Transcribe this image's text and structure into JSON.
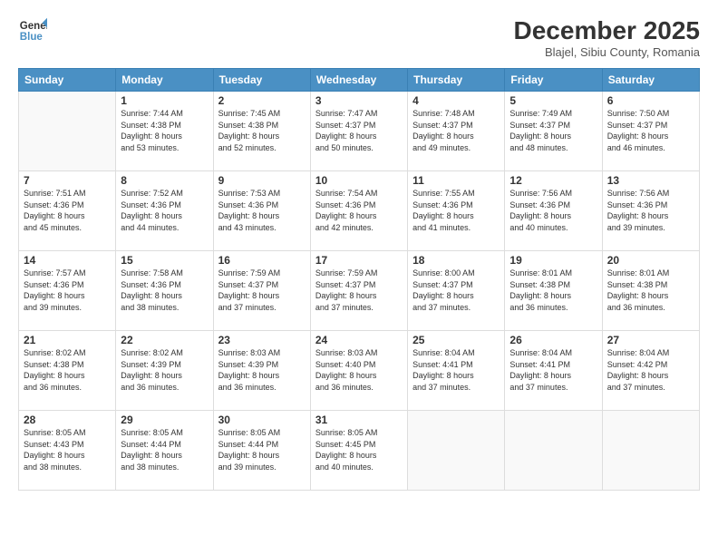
{
  "logo": {
    "line1": "General",
    "line2": "Blue"
  },
  "title": "December 2025",
  "location": "Blajel, Sibiu County, Romania",
  "days_of_week": [
    "Sunday",
    "Monday",
    "Tuesday",
    "Wednesday",
    "Thursday",
    "Friday",
    "Saturday"
  ],
  "weeks": [
    [
      {
        "day": null,
        "info": null
      },
      {
        "day": "1",
        "info": "Sunrise: 7:44 AM\nSunset: 4:38 PM\nDaylight: 8 hours\nand 53 minutes."
      },
      {
        "day": "2",
        "info": "Sunrise: 7:45 AM\nSunset: 4:38 PM\nDaylight: 8 hours\nand 52 minutes."
      },
      {
        "day": "3",
        "info": "Sunrise: 7:47 AM\nSunset: 4:37 PM\nDaylight: 8 hours\nand 50 minutes."
      },
      {
        "day": "4",
        "info": "Sunrise: 7:48 AM\nSunset: 4:37 PM\nDaylight: 8 hours\nand 49 minutes."
      },
      {
        "day": "5",
        "info": "Sunrise: 7:49 AM\nSunset: 4:37 PM\nDaylight: 8 hours\nand 48 minutes."
      },
      {
        "day": "6",
        "info": "Sunrise: 7:50 AM\nSunset: 4:37 PM\nDaylight: 8 hours\nand 46 minutes."
      }
    ],
    [
      {
        "day": "7",
        "info": "Sunrise: 7:51 AM\nSunset: 4:36 PM\nDaylight: 8 hours\nand 45 minutes."
      },
      {
        "day": "8",
        "info": "Sunrise: 7:52 AM\nSunset: 4:36 PM\nDaylight: 8 hours\nand 44 minutes."
      },
      {
        "day": "9",
        "info": "Sunrise: 7:53 AM\nSunset: 4:36 PM\nDaylight: 8 hours\nand 43 minutes."
      },
      {
        "day": "10",
        "info": "Sunrise: 7:54 AM\nSunset: 4:36 PM\nDaylight: 8 hours\nand 42 minutes."
      },
      {
        "day": "11",
        "info": "Sunrise: 7:55 AM\nSunset: 4:36 PM\nDaylight: 8 hours\nand 41 minutes."
      },
      {
        "day": "12",
        "info": "Sunrise: 7:56 AM\nSunset: 4:36 PM\nDaylight: 8 hours\nand 40 minutes."
      },
      {
        "day": "13",
        "info": "Sunrise: 7:56 AM\nSunset: 4:36 PM\nDaylight: 8 hours\nand 39 minutes."
      }
    ],
    [
      {
        "day": "14",
        "info": "Sunrise: 7:57 AM\nSunset: 4:36 PM\nDaylight: 8 hours\nand 39 minutes."
      },
      {
        "day": "15",
        "info": "Sunrise: 7:58 AM\nSunset: 4:36 PM\nDaylight: 8 hours\nand 38 minutes."
      },
      {
        "day": "16",
        "info": "Sunrise: 7:59 AM\nSunset: 4:37 PM\nDaylight: 8 hours\nand 37 minutes."
      },
      {
        "day": "17",
        "info": "Sunrise: 7:59 AM\nSunset: 4:37 PM\nDaylight: 8 hours\nand 37 minutes."
      },
      {
        "day": "18",
        "info": "Sunrise: 8:00 AM\nSunset: 4:37 PM\nDaylight: 8 hours\nand 37 minutes."
      },
      {
        "day": "19",
        "info": "Sunrise: 8:01 AM\nSunset: 4:38 PM\nDaylight: 8 hours\nand 36 minutes."
      },
      {
        "day": "20",
        "info": "Sunrise: 8:01 AM\nSunset: 4:38 PM\nDaylight: 8 hours\nand 36 minutes."
      }
    ],
    [
      {
        "day": "21",
        "info": "Sunrise: 8:02 AM\nSunset: 4:38 PM\nDaylight: 8 hours\nand 36 minutes."
      },
      {
        "day": "22",
        "info": "Sunrise: 8:02 AM\nSunset: 4:39 PM\nDaylight: 8 hours\nand 36 minutes."
      },
      {
        "day": "23",
        "info": "Sunrise: 8:03 AM\nSunset: 4:39 PM\nDaylight: 8 hours\nand 36 minutes."
      },
      {
        "day": "24",
        "info": "Sunrise: 8:03 AM\nSunset: 4:40 PM\nDaylight: 8 hours\nand 36 minutes."
      },
      {
        "day": "25",
        "info": "Sunrise: 8:04 AM\nSunset: 4:41 PM\nDaylight: 8 hours\nand 37 minutes."
      },
      {
        "day": "26",
        "info": "Sunrise: 8:04 AM\nSunset: 4:41 PM\nDaylight: 8 hours\nand 37 minutes."
      },
      {
        "day": "27",
        "info": "Sunrise: 8:04 AM\nSunset: 4:42 PM\nDaylight: 8 hours\nand 37 minutes."
      }
    ],
    [
      {
        "day": "28",
        "info": "Sunrise: 8:05 AM\nSunset: 4:43 PM\nDaylight: 8 hours\nand 38 minutes."
      },
      {
        "day": "29",
        "info": "Sunrise: 8:05 AM\nSunset: 4:44 PM\nDaylight: 8 hours\nand 38 minutes."
      },
      {
        "day": "30",
        "info": "Sunrise: 8:05 AM\nSunset: 4:44 PM\nDaylight: 8 hours\nand 39 minutes."
      },
      {
        "day": "31",
        "info": "Sunrise: 8:05 AM\nSunset: 4:45 PM\nDaylight: 8 hours\nand 40 minutes."
      },
      {
        "day": null,
        "info": null
      },
      {
        "day": null,
        "info": null
      },
      {
        "day": null,
        "info": null
      }
    ]
  ]
}
